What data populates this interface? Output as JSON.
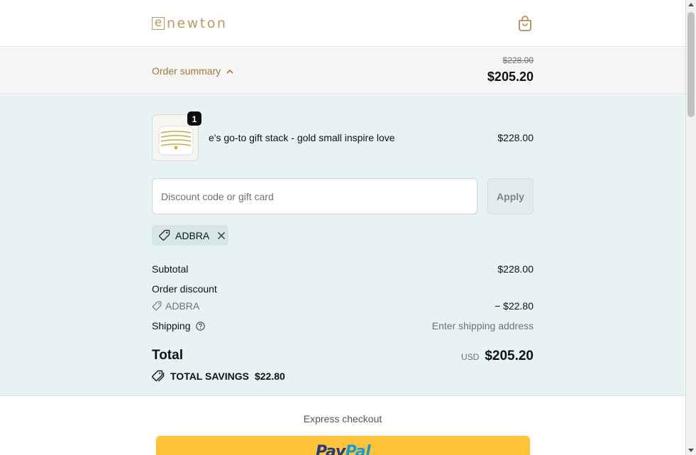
{
  "header": {
    "logo_mark": "e",
    "logo_text": "newton",
    "cart_icon": "shopping-bag-icon"
  },
  "summary_bar": {
    "toggle_label": "Order summary",
    "original_price": "$228.00",
    "discounted_price": "$205.20"
  },
  "product": {
    "quantity": "1",
    "name": "e's go-to gift stack - gold small inspire love",
    "price": "$228.00"
  },
  "discount": {
    "placeholder": "Discount code or gift card",
    "value": "",
    "apply_label": "Apply",
    "applied_code": "ADBRA"
  },
  "totals": {
    "subtotal_label": "Subtotal",
    "subtotal_value": "$228.00",
    "order_discount_label": "Order discount",
    "discount_code": "ADBRA",
    "discount_value": "− $22.80",
    "shipping_label": "Shipping",
    "shipping_value": "Enter shipping address",
    "total_label": "Total",
    "currency": "USD",
    "total_value": "$205.20",
    "savings_label": "TOTAL SAVINGS",
    "savings_value": "$22.80"
  },
  "express": {
    "label": "Express checkout",
    "paypal_part1": "Pay",
    "paypal_part2": "Pal"
  },
  "colors": {
    "brand_gold": "#b89a62",
    "summary_toggle": "#a6773a",
    "details_bg": "#e6f2f3",
    "paypal_yellow": "#ffc43a"
  }
}
